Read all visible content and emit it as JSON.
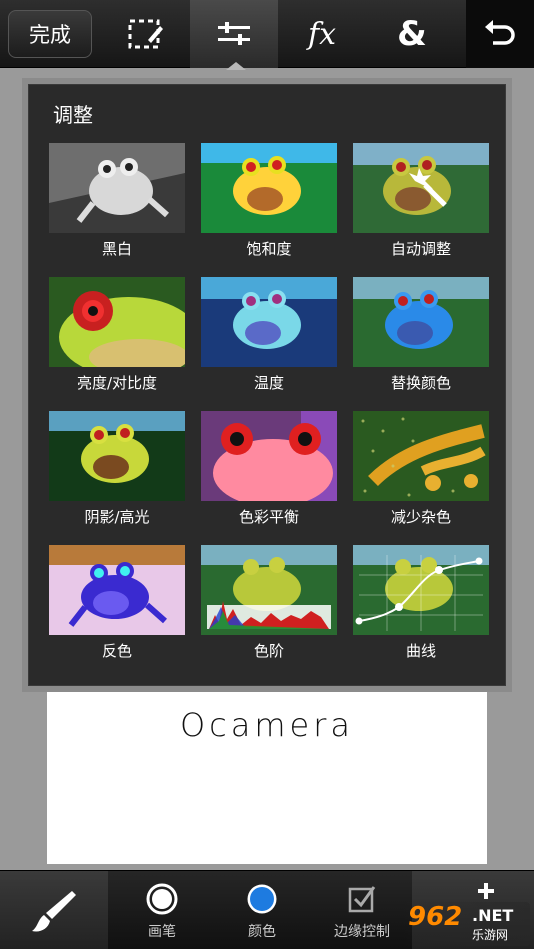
{
  "toolbar": {
    "done_label": "完成",
    "tools": [
      {
        "name": "select-tool",
        "icon": "dashed-selection-pencil-icon"
      },
      {
        "name": "adjust-tool",
        "icon": "sliders-icon",
        "active": true
      },
      {
        "name": "effects-tool",
        "label": "fx"
      },
      {
        "name": "layers-tool",
        "label": "&"
      }
    ],
    "undo_icon": "undo-icon"
  },
  "panel": {
    "title": "调整",
    "items": [
      {
        "label": "黑白"
      },
      {
        "label": "饱和度"
      },
      {
        "label": "自动调整"
      },
      {
        "label": "亮度/对比度"
      },
      {
        "label": "温度"
      },
      {
        "label": "替换颜色"
      },
      {
        "label": "阴影/高光"
      },
      {
        "label": "色彩平衡"
      },
      {
        "label": "减少杂色"
      },
      {
        "label": "反色"
      },
      {
        "label": "色阶"
      },
      {
        "label": "曲线"
      }
    ]
  },
  "canvas": {
    "text": "Ocamera"
  },
  "bottombar": {
    "brush_icon": "brush-icon",
    "tools": [
      {
        "label": "画笔"
      },
      {
        "label": "颜色"
      },
      {
        "label": "边缘控制"
      }
    ],
    "add_icon": "add-layer-icon"
  },
  "watermark": {
    "number": "962",
    "net": ".NET",
    "sub": "乐游网"
  },
  "colors": {
    "color_swatch": "#1e7be0"
  }
}
